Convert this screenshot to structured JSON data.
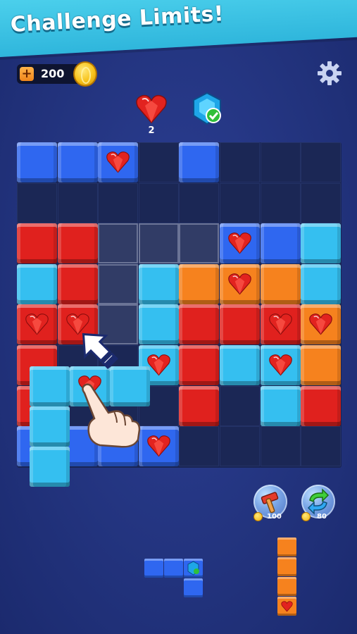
{
  "banner": {
    "title": "Challenge Limits!"
  },
  "header": {
    "coins": "200"
  },
  "goals": {
    "heart_count": "2",
    "gem_status": "complete"
  },
  "boosters": [
    {
      "name": "hammer",
      "price": "100"
    },
    {
      "name": "refresh",
      "price": "80"
    }
  ],
  "board": {
    "rows": [
      [
        "blue",
        "blue",
        "blue-heart",
        "empty",
        "blue",
        "empty",
        "empty",
        "empty"
      ],
      [
        "empty",
        "empty",
        "empty",
        "empty",
        "empty",
        "empty",
        "empty",
        "empty"
      ],
      [
        "red",
        "red",
        "hint",
        "hint",
        "hint",
        "blue-heart",
        "blue",
        "cyan"
      ],
      [
        "cyan",
        "red",
        "hint",
        "cyan",
        "orange",
        "orange-heart",
        "orange",
        "cyan"
      ],
      [
        "red-heart",
        "red-heart",
        "hint",
        "cyan",
        "red",
        "red",
        "red-heart",
        "orange-heart"
      ],
      [
        "red",
        "empty",
        "empty",
        "cyan-heart",
        "red",
        "cyan",
        "cyan-heart",
        "orange"
      ],
      [
        "red",
        "empty",
        "empty",
        "empty",
        "red",
        "empty",
        "cyan",
        "red"
      ],
      [
        "blue",
        "blue",
        "blue",
        "blue-heart",
        "empty",
        "empty",
        "empty",
        "empty"
      ]
    ]
  },
  "colors": {
    "blue": "#2f67f0",
    "red": "#e0211e",
    "cyan": "#35bff0",
    "orange": "#f6821e"
  }
}
